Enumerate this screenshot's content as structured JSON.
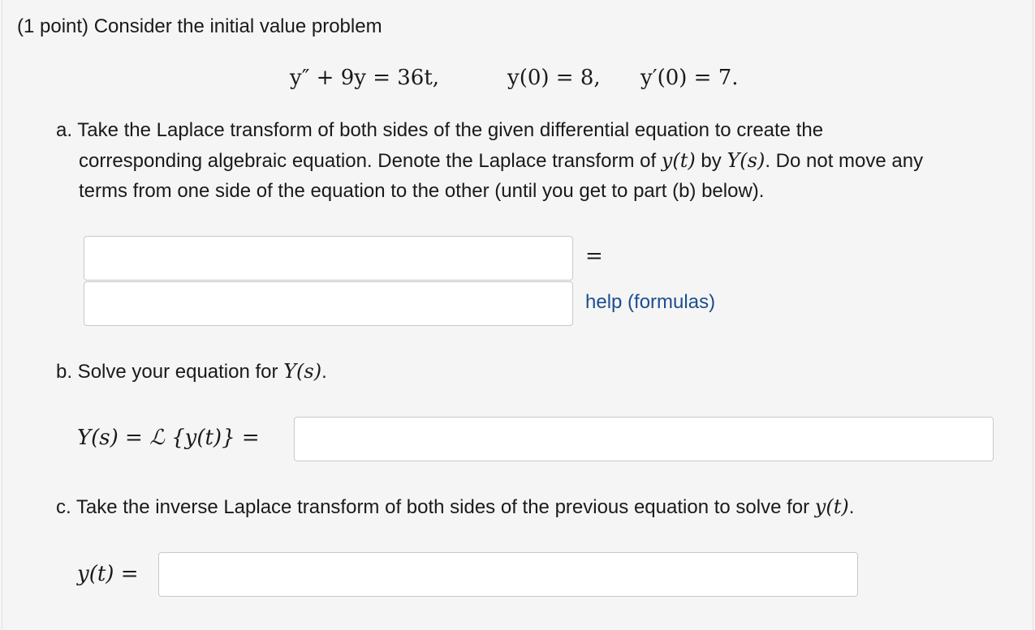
{
  "header": {
    "points": "(1 point) Consider the initial value problem"
  },
  "equation": {
    "ode_lhs": "y″ + 9y = 36t,",
    "ic1": "y(0) = 8,",
    "ic2": "y′(0) = 7."
  },
  "part_a": {
    "line1": "a. Take the Laplace transform of both sides of the given differential equation to create the",
    "line2_prefix": "corresponding algebraic equation. Denote the Laplace transform of",
    "line2_yt": "y(t)",
    "line2_by": "by",
    "line2_Ys": "Y(s)",
    "line2_suffix": ". Do not move any",
    "line3": "terms from one side of the equation to the other (until you get to part (b) below).",
    "equals": "=",
    "help_link": "help (formulas)",
    "lhs_value": "",
    "rhs_value": ""
  },
  "part_b": {
    "prompt_prefix": "b. Solve your equation for",
    "prompt_Ys": "Y(s)",
    "prompt_suffix": ".",
    "label": "Y(s) = ℒ {y(t)} =",
    "value": ""
  },
  "part_c": {
    "prompt_prefix": "c. Take the inverse Laplace transform of both sides of the previous equation to solve for",
    "prompt_yt": "y(t)",
    "prompt_suffix": ".",
    "label": "y(t) =",
    "value": ""
  }
}
